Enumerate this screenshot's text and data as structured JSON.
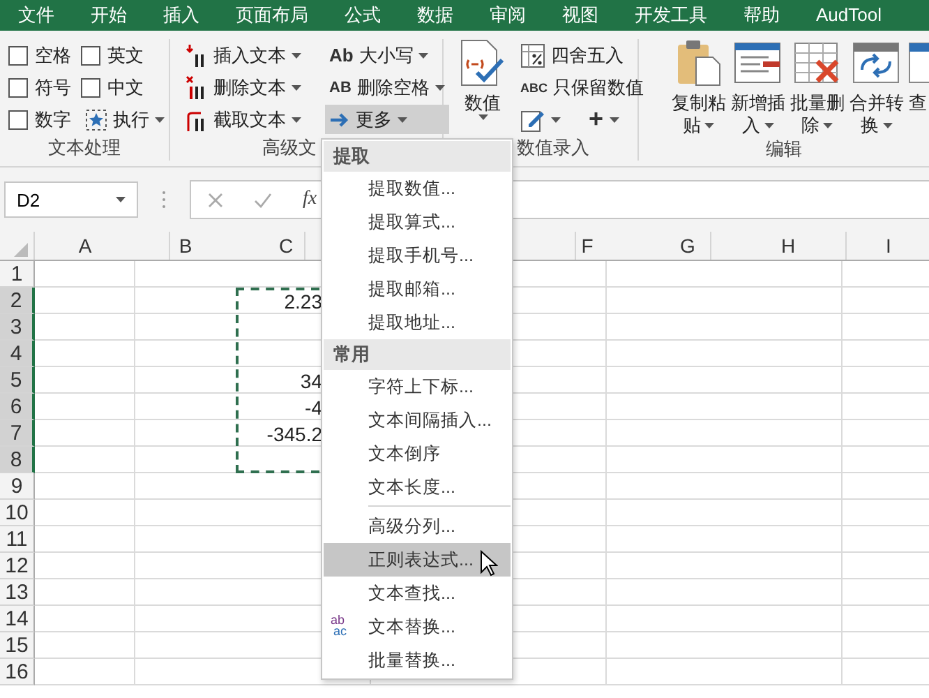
{
  "tabs": [
    {
      "label": "文件"
    },
    {
      "label": "开始"
    },
    {
      "label": "插入"
    },
    {
      "label": "页面布局"
    },
    {
      "label": "公式"
    },
    {
      "label": "数据"
    },
    {
      "label": "审阅"
    },
    {
      "label": "视图"
    },
    {
      "label": "开发工具"
    },
    {
      "label": "帮助"
    },
    {
      "label": "AudTool"
    }
  ],
  "ribbon": {
    "groups": [
      {
        "kind": "checks",
        "label": "文本处理",
        "items": [
          {
            "label": "空格",
            "checked": false
          },
          {
            "label": "英文",
            "checked": false
          },
          {
            "label": "符号",
            "checked": false
          },
          {
            "label": "中文",
            "checked": false
          },
          {
            "label": "数字",
            "checked": false
          }
        ],
        "run_button": {
          "label": "执行"
        }
      },
      {
        "kind": "text",
        "label": "高级文",
        "left": [
          {
            "label": "插入文本"
          },
          {
            "label": "删除文本"
          },
          {
            "label": "截取文本"
          }
        ],
        "right": [
          {
            "glyph": "Ab",
            "label": "大小写",
            "open": false
          },
          {
            "glyph": "AB",
            "label": "删除空格",
            "open": false
          },
          {
            "label": "更多",
            "open": true
          }
        ]
      },
      {
        "kind": "number",
        "label": "数值录入",
        "big_button": {
          "label": "数值"
        },
        "items": [
          {
            "label": "四舍五入"
          },
          {
            "glyph": "ABC",
            "label": "只保留数值"
          }
        ],
        "plus_button": {
          "glyph": "+"
        }
      },
      {
        "kind": "edit",
        "label": "编辑",
        "buttons": [
          {
            "lines": [
              "复制粘",
              "贴"
            ]
          },
          {
            "lines": [
              "新增插",
              "入"
            ]
          },
          {
            "lines": [
              "批量删",
              "除"
            ]
          },
          {
            "lines": [
              "合并转",
              "换"
            ]
          },
          {
            "lines": [
              "查"
            ]
          }
        ]
      }
    ]
  },
  "formula_bar": {
    "name_box": "D2",
    "fx": "fx"
  },
  "sheet": {
    "columns": [
      "A",
      "B",
      "C",
      null,
      null,
      "F",
      "G",
      "H",
      "I"
    ],
    "copy_marquee": true,
    "rows": [
      {
        "number": "1",
        "selected": false
      },
      {
        "number": "2",
        "selected": true,
        "column_c": "2.23"
      },
      {
        "number": "3",
        "selected": true
      },
      {
        "number": "4",
        "selected": true
      },
      {
        "number": "5",
        "selected": true,
        "column_c": "34"
      },
      {
        "number": "6",
        "selected": true,
        "column_c": "-4"
      },
      {
        "number": "7",
        "selected": true,
        "column_c": "-345.2"
      },
      {
        "number": "8",
        "selected": true
      },
      {
        "number": "9",
        "selected": false
      },
      {
        "number": "10",
        "selected": false
      },
      {
        "number": "11",
        "selected": false
      },
      {
        "number": "12",
        "selected": false
      },
      {
        "number": "13",
        "selected": false
      },
      {
        "number": "14",
        "selected": false
      },
      {
        "number": "15",
        "selected": false
      },
      {
        "number": "16",
        "selected": false
      }
    ]
  },
  "menu": {
    "sections": [
      {
        "title": "提取",
        "items": [
          {
            "label": "提取数值...",
            "selected": false
          },
          {
            "label": "提取算式...",
            "selected": false
          },
          {
            "label": "提取手机号...",
            "selected": false
          },
          {
            "label": "提取邮箱...",
            "selected": false
          },
          {
            "label": "提取地址...",
            "selected": false
          }
        ]
      },
      {
        "title": "常用",
        "items": [
          {
            "label": "字符上下标...",
            "selected": false
          },
          {
            "label": "文本间隔插入...",
            "selected": false
          },
          {
            "label": "文本倒序",
            "selected": false
          },
          {
            "label": "文本长度...",
            "selected": false
          },
          {
            "label": "高级分列...",
            "selected": false,
            "separator_before": true
          },
          {
            "label": "正则表达式...",
            "selected": true
          },
          {
            "label": "文本查找...",
            "selected": false
          },
          {
            "label": "文本替换...",
            "selected": false,
            "icon_text": [
              "ab",
              "ac"
            ]
          },
          {
            "label": "批量替换...",
            "selected": false
          }
        ]
      }
    ]
  }
}
